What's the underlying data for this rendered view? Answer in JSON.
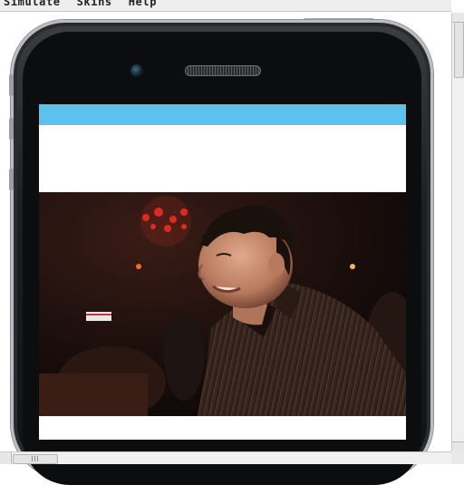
{
  "menu": {
    "items": [
      "Simulate",
      "Skins",
      "Help"
    ]
  },
  "screen": {
    "header_color": "#5bc2ef",
    "photo_description_icon": "person-photo"
  },
  "icons": {
    "camera": "camera-lens-icon",
    "speaker": "earpiece-speaker-icon"
  },
  "scroll": {
    "vertical_position": 0.02,
    "horizontal_position": 0.02
  }
}
